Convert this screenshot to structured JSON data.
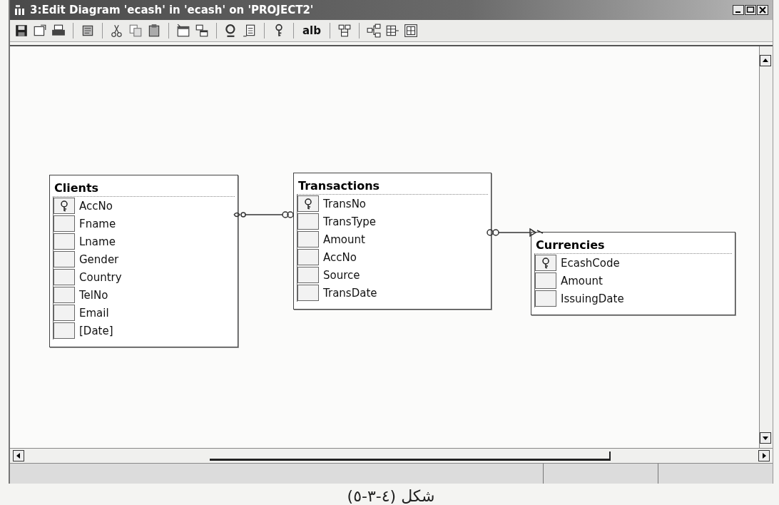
{
  "window": {
    "title": "3:Edit Diagram 'ecash' in 'ecash' on 'PROJECT2'"
  },
  "toolbar": {
    "text_button": "alb"
  },
  "tables": [
    {
      "name": "Clients",
      "columns": [
        {
          "name": "AccNo",
          "primary_key": true
        },
        {
          "name": "Fname",
          "primary_key": false
        },
        {
          "name": "Lname",
          "primary_key": false
        },
        {
          "name": "Gender",
          "primary_key": false
        },
        {
          "name": "Country",
          "primary_key": false
        },
        {
          "name": "TelNo",
          "primary_key": false
        },
        {
          "name": "Email",
          "primary_key": false
        },
        {
          "name": "[Date]",
          "primary_key": false
        }
      ]
    },
    {
      "name": "Transactions",
      "columns": [
        {
          "name": "TransNo",
          "primary_key": true
        },
        {
          "name": "TransType",
          "primary_key": false
        },
        {
          "name": "Amount",
          "primary_key": false
        },
        {
          "name": "AccNo",
          "primary_key": false
        },
        {
          "name": "Source",
          "primary_key": false
        },
        {
          "name": "TransDate",
          "primary_key": false
        }
      ]
    },
    {
      "name": "Currencies",
      "columns": [
        {
          "name": "EcashCode",
          "primary_key": true
        },
        {
          "name": "Amount",
          "primary_key": false
        },
        {
          "name": "IssuingDate",
          "primary_key": false
        }
      ]
    }
  ],
  "caption": "شكل (٤-٣-٥)"
}
